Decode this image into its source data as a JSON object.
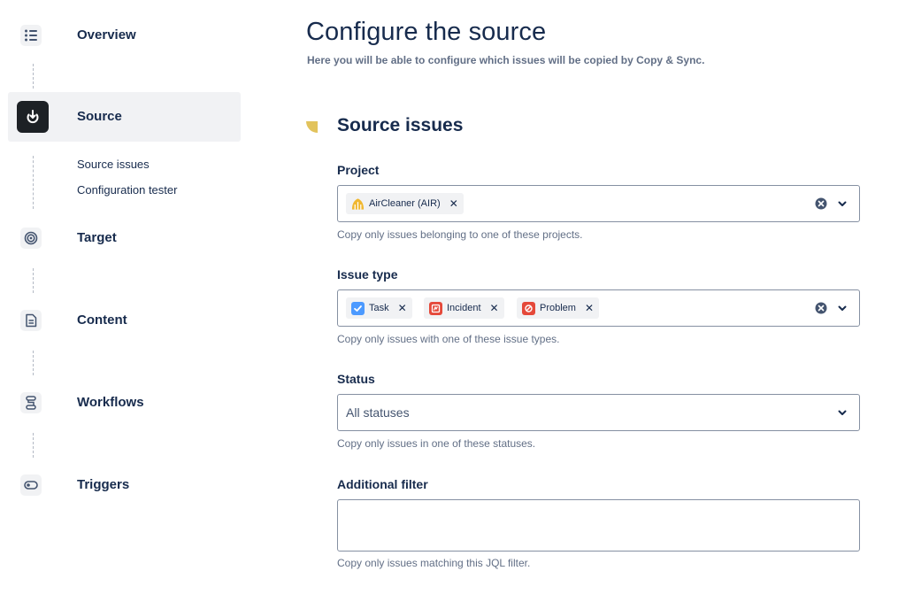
{
  "sidebar": {
    "steps": [
      {
        "label": "Overview",
        "icon": "list-icon"
      },
      {
        "label": "Source",
        "icon": "source-icon"
      },
      {
        "label": "Target",
        "icon": "target-icon"
      },
      {
        "label": "Content",
        "icon": "document-icon"
      },
      {
        "label": "Workflows",
        "icon": "workflow-icon"
      },
      {
        "label": "Triggers",
        "icon": "toggle-icon"
      }
    ],
    "active_step": "Source",
    "substeps": [
      "Source issues",
      "Configuration tester"
    ]
  },
  "main": {
    "title": "Configure the source",
    "subtitle": "Here you will be able to configure which issues will be copied by Copy & Sync.",
    "section_title": "Source issues",
    "fields": {
      "project": {
        "label": "Project",
        "tags": [
          {
            "label": "AirCleaner (AIR)",
            "icon": "project-avatar-icon"
          }
        ],
        "help": "Copy only issues belonging to one of these projects."
      },
      "issue_type": {
        "label": "Issue type",
        "tags": [
          {
            "label": "Task",
            "icon": "task-checkbox-icon",
            "color": "#4c9aff"
          },
          {
            "label": "Incident",
            "icon": "incident-icon",
            "color": "#e5493a"
          },
          {
            "label": "Problem",
            "icon": "problem-icon",
            "color": "#e5493a"
          }
        ],
        "help": "Copy only issues with one of these issue types."
      },
      "status": {
        "label": "Status",
        "value": "All statuses",
        "help": "Copy only issues in one of these statuses."
      },
      "additional_filter": {
        "label": "Additional filter",
        "value": "",
        "help": "Copy only issues matching this JQL filter."
      }
    }
  },
  "colors": {
    "text": "#172b4d",
    "subtle_text": "#626f86",
    "active_step_bg": "#f1f2f4",
    "active_icon_bg": "#1d2125",
    "section_accent": "#e2c35c",
    "border": "#8590a2"
  }
}
